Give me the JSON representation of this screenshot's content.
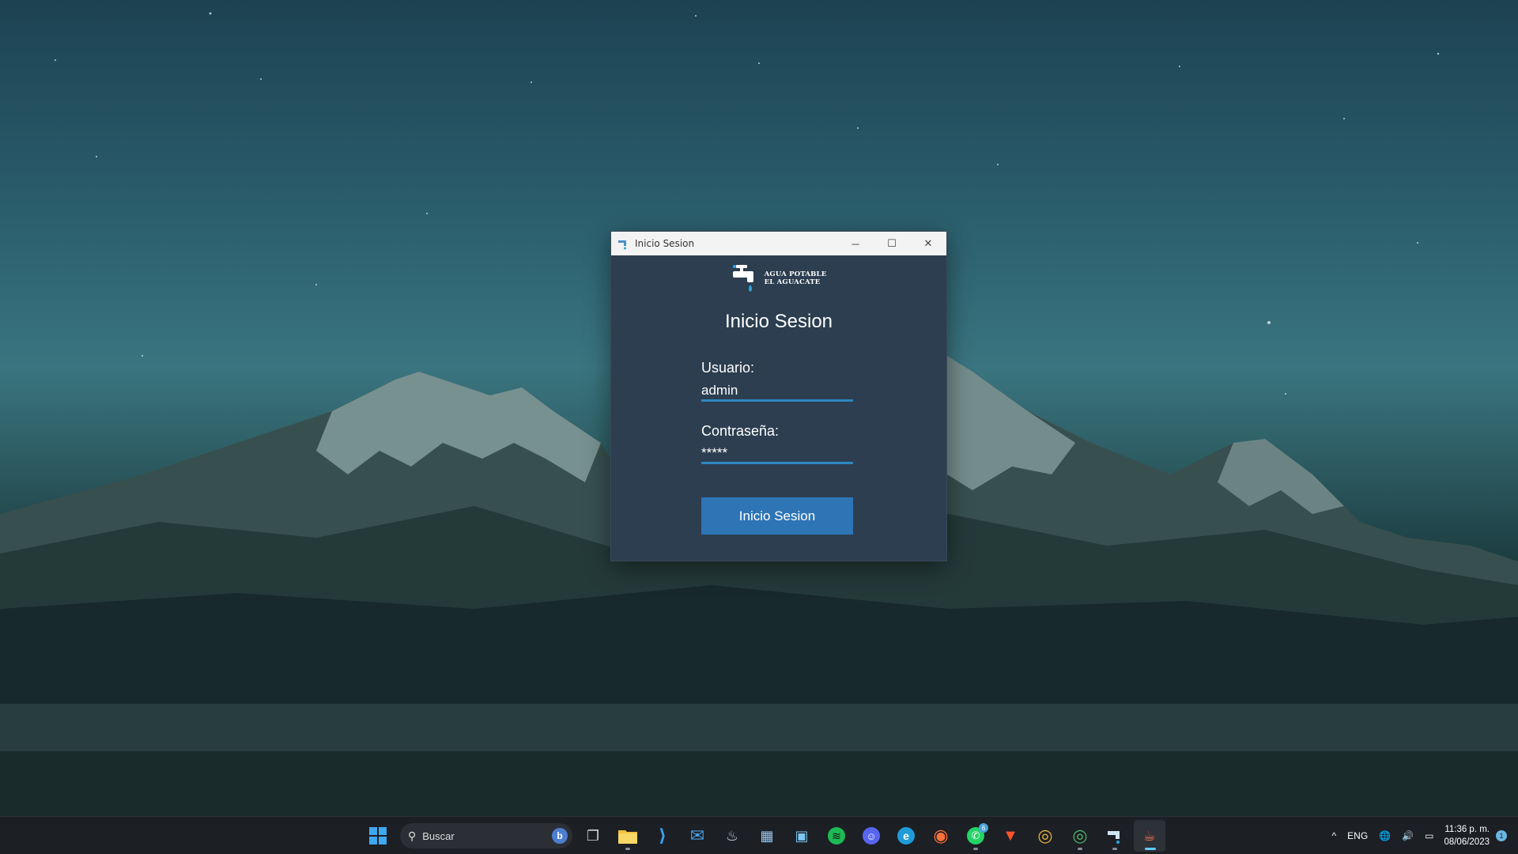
{
  "window": {
    "title": "Inicio Sesion",
    "minimize_glyph": "─",
    "maximize_glyph": "☐",
    "close_glyph": "✕",
    "logo_line1": "AGUA POTABLE",
    "logo_line2": "EL AGUACATE",
    "heading": "Inicio Sesion",
    "user_label": "Usuario:",
    "user_value": "admin",
    "password_label": "Contraseña:",
    "password_value": "*****",
    "login_button": "Inicio Sesion",
    "accent_color": "#2e75b6",
    "background_color": "#2c3e50"
  },
  "taskbar": {
    "search_placeholder": "Buscar",
    "search_glyph": "⚲",
    "bing_glyph": "b",
    "apps": [
      {
        "name": "start-icon",
        "glyph": ""
      },
      {
        "name": "task-view-icon",
        "glyph": "❐"
      },
      {
        "name": "file-explorer-icon",
        "glyph": ""
      },
      {
        "name": "vscode-icon",
        "glyph": "⟩"
      },
      {
        "name": "mail-icon",
        "glyph": "✉"
      },
      {
        "name": "steam-icon",
        "glyph": "♨"
      },
      {
        "name": "photos-icon",
        "glyph": "▦"
      },
      {
        "name": "control-panel-icon",
        "glyph": "▣"
      },
      {
        "name": "spotify-icon",
        "glyph": "≋"
      },
      {
        "name": "discord-icon",
        "glyph": "☺"
      },
      {
        "name": "edge-icon",
        "glyph": "e"
      },
      {
        "name": "firefox-icon",
        "glyph": "◉"
      },
      {
        "name": "whatsapp-icon",
        "glyph": "✆",
        "badge": "6"
      },
      {
        "name": "brave-icon",
        "glyph": "▼"
      },
      {
        "name": "chrome-icon",
        "glyph": "◎"
      },
      {
        "name": "chrome-profile-icon",
        "glyph": "◎"
      },
      {
        "name": "water-app-icon",
        "glyph": "⚲"
      },
      {
        "name": "java-app-icon",
        "glyph": "☕"
      }
    ],
    "tray": {
      "chevron": "^",
      "language": "ENG",
      "network_glyph": "🌐",
      "volume_glyph": "🔊",
      "battery_glyph": "▭",
      "time": "11:36 p. m.",
      "date": "08/06/2023",
      "notification_count": "1"
    }
  }
}
